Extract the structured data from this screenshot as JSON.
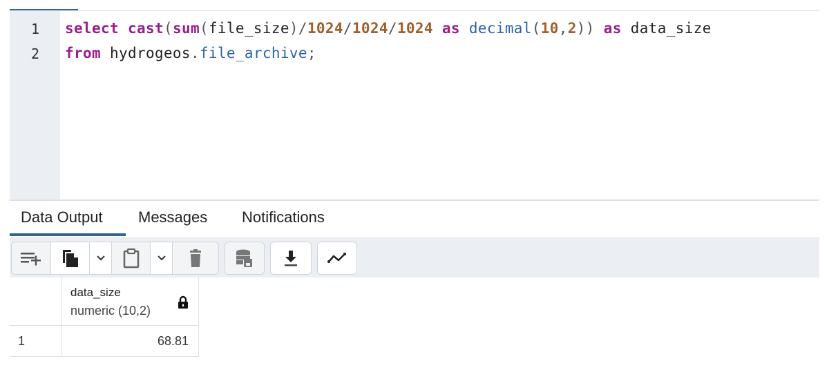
{
  "editor": {
    "line_numbers": [
      "1",
      "2"
    ],
    "lines": [
      {
        "tokens": [
          {
            "t": "select",
            "k": "kw"
          },
          {
            "t": " ",
            "k": "ident"
          },
          {
            "t": "cast",
            "k": "fn"
          },
          {
            "t": "(",
            "k": "punc"
          },
          {
            "t": "sum",
            "k": "fn"
          },
          {
            "t": "(",
            "k": "punc"
          },
          {
            "t": "file_size",
            "k": "ident"
          },
          {
            "t": ")/",
            "k": "punc"
          },
          {
            "t": "1024",
            "k": "num"
          },
          {
            "t": "/",
            "k": "punc"
          },
          {
            "t": "1024",
            "k": "num"
          },
          {
            "t": "/",
            "k": "punc"
          },
          {
            "t": "1024",
            "k": "num"
          },
          {
            "t": " ",
            "k": "ident"
          },
          {
            "t": "as",
            "k": "kw"
          },
          {
            "t": " ",
            "k": "ident"
          },
          {
            "t": "decimal",
            "k": "typ"
          },
          {
            "t": "(",
            "k": "punc"
          },
          {
            "t": "10",
            "k": "num"
          },
          {
            "t": ",",
            "k": "punc"
          },
          {
            "t": "2",
            "k": "num"
          },
          {
            "t": "))",
            "k": "punc"
          },
          {
            "t": " ",
            "k": "ident"
          },
          {
            "t": "as",
            "k": "kw"
          },
          {
            "t": " ",
            "k": "ident"
          },
          {
            "t": "data_size",
            "k": "ident"
          }
        ]
      },
      {
        "tokens": [
          {
            "t": "from",
            "k": "kw"
          },
          {
            "t": " ",
            "k": "ident"
          },
          {
            "t": "hydrogeos",
            "k": "ident"
          },
          {
            "t": ".",
            "k": "punc"
          },
          {
            "t": "file_archive",
            "k": "prop"
          },
          {
            "t": ";",
            "k": "punc"
          }
        ]
      }
    ]
  },
  "output_tabs": [
    {
      "label": "Data Output",
      "active": true
    },
    {
      "label": "Messages",
      "active": false
    },
    {
      "label": "Notifications",
      "active": false
    }
  ],
  "toolbar": {
    "buttons": [
      {
        "name": "add-row",
        "icon": "add-row-icon"
      },
      {
        "name": "copy",
        "icon": "copy-icon"
      },
      {
        "name": "copy-options",
        "icon": "chevron-down-icon"
      },
      {
        "name": "paste",
        "icon": "clipboard-icon"
      },
      {
        "name": "paste-options",
        "icon": "chevron-down-icon"
      },
      {
        "name": "delete",
        "icon": "trash-icon"
      },
      {
        "name": "save-data",
        "icon": "database-save-icon"
      },
      {
        "name": "download",
        "icon": "download-icon"
      },
      {
        "name": "graph-visualiser",
        "icon": "line-chart-icon"
      }
    ]
  },
  "result_grid": {
    "columns": [
      {
        "name": "data_size",
        "type": "numeric (10,2)",
        "locked": true
      }
    ],
    "rows": [
      {
        "row_number": "1",
        "values": [
          "68.81"
        ]
      }
    ]
  },
  "colors": {
    "accent": "#326690",
    "keyword": "#9b1d8f",
    "number": "#a0602c",
    "type": "#2a63a8",
    "gutter_bg": "#ebeef3"
  }
}
